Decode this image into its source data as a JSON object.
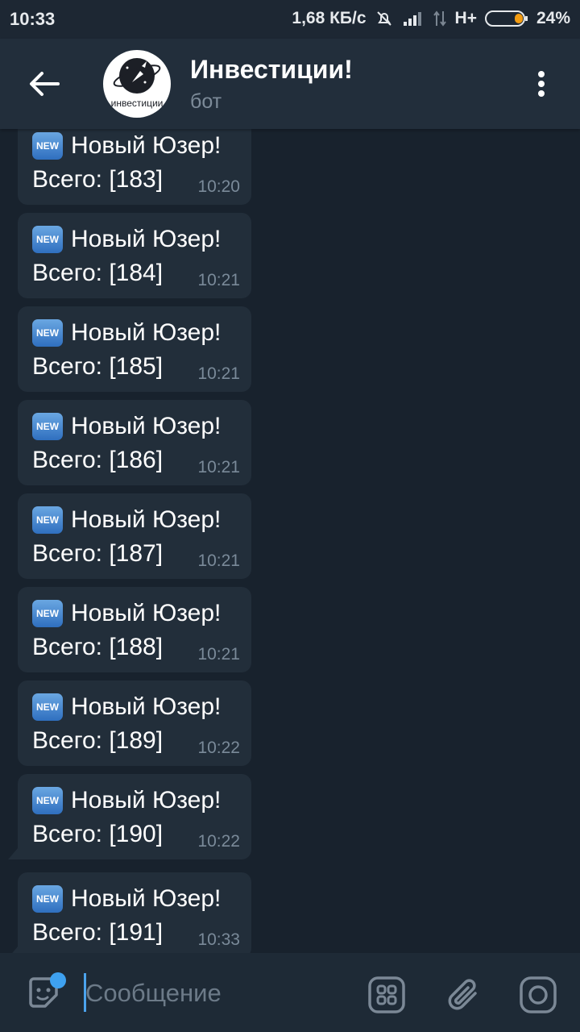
{
  "status_bar": {
    "time": "10:33",
    "speed": "1,68 КБ/с",
    "network": "H+",
    "battery": "24%",
    "icons": [
      "mute-bell-icon",
      "signal-icon",
      "data-arrows-icon",
      "battery-icon"
    ]
  },
  "header": {
    "back_icon": "arrow-left-icon",
    "avatar_text": "инвестиции",
    "title": "Инвестиции!",
    "subtitle": "бот",
    "menu_icon": "more-vertical-icon"
  },
  "messages": [
    {
      "badge": "NEW",
      "line1": "Новый Юзер!",
      "line2": "Всего: [183]",
      "time": "10:20",
      "tail": false
    },
    {
      "badge": "NEW",
      "line1": "Новый Юзер!",
      "line2": "Всего: [184]",
      "time": "10:21",
      "tail": false
    },
    {
      "badge": "NEW",
      "line1": "Новый Юзер!",
      "line2": "Всего: [185]",
      "time": "10:21",
      "tail": false
    },
    {
      "badge": "NEW",
      "line1": "Новый Юзер!",
      "line2": "Всего: [186]",
      "time": "10:21",
      "tail": false
    },
    {
      "badge": "NEW",
      "line1": "Новый Юзер!",
      "line2": "Всего: [187]",
      "time": "10:21",
      "tail": false
    },
    {
      "badge": "NEW",
      "line1": "Новый Юзер!",
      "line2": "Всего: [188]",
      "time": "10:21",
      "tail": false
    },
    {
      "badge": "NEW",
      "line1": "Новый Юзер!",
      "line2": "Всего: [189]",
      "time": "10:22",
      "tail": false
    },
    {
      "badge": "NEW",
      "line1": "Новый Юзер!",
      "line2": "Всего: [190]",
      "time": "10:22",
      "tail": true
    },
    {
      "badge": "NEW",
      "line1": "Новый Юзер!",
      "line2": "Всего: [191]",
      "time": "10:33",
      "tail": true
    }
  ],
  "composer": {
    "placeholder": "Сообщение",
    "value": "",
    "icons": [
      "sticker-icon",
      "bot-commands-icon",
      "paperclip-icon",
      "camera-icon"
    ]
  },
  "colors": {
    "background": "#18222d",
    "header": "#222e3b",
    "bubble": "#222e3a",
    "accent": "#3ea1f0",
    "battery_fill": "#f39c12"
  }
}
